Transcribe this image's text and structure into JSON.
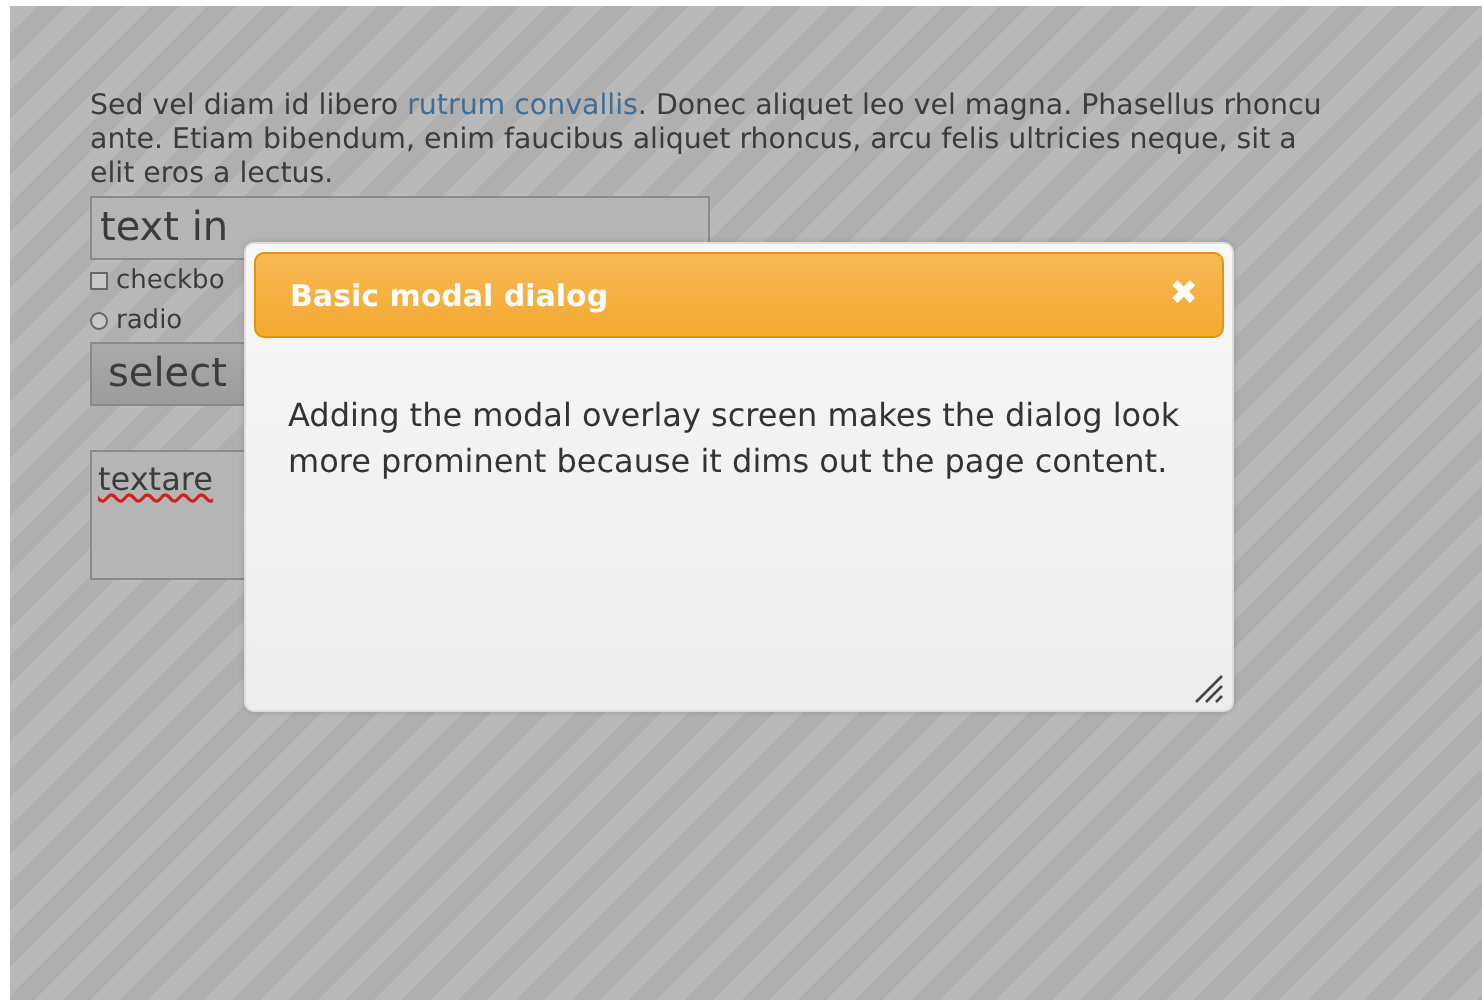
{
  "page": {
    "paragraph": {
      "before": "Sed vel diam id libero ",
      "link": "rutrum convallis",
      "after": ". Donec aliquet leo vel magna. Phasellus rhoncu",
      "line_2": "ante. Etiam bibendum, enim faucibus aliquet rhoncus, arcu felis ultricies neque, sit a",
      "line_3": "elit eros a lectus."
    },
    "text_input": {
      "value": "text in"
    },
    "checkbox": {
      "label": "checkbo",
      "checked": false
    },
    "radio": {
      "label": "radio",
      "selected": false
    },
    "select": {
      "value": "select"
    },
    "textarea": {
      "value": "textare"
    }
  },
  "dialog": {
    "title": "Basic modal dialog",
    "close": "✖",
    "body": "Adding the modal overlay screen makes the dialog look more prominent because it dims out the page content.",
    "resizable": true
  }
}
